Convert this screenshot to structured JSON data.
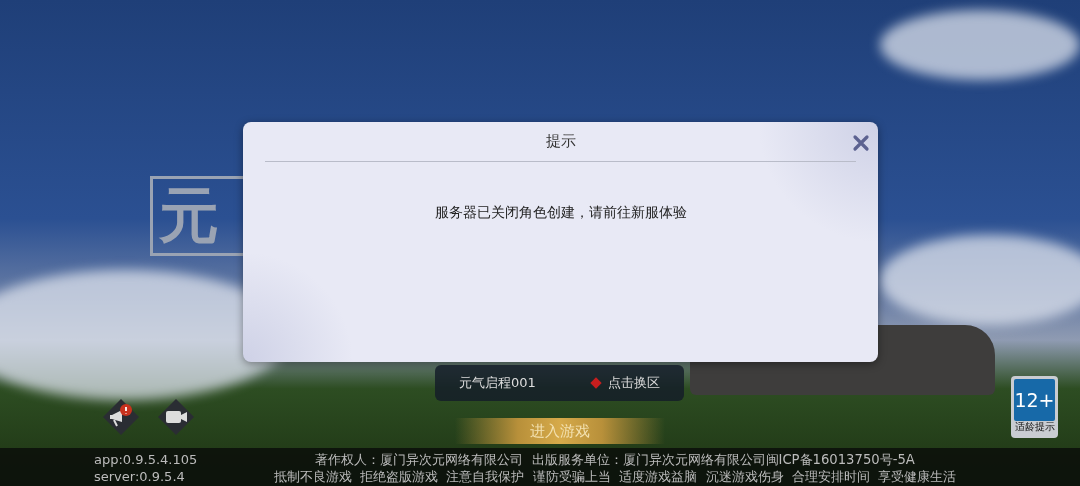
{
  "background_logo": {
    "text": "元"
  },
  "dialog": {
    "title": "提示",
    "message": "服务器已关闭角色创建，请前往新服体验"
  },
  "server_selector": {
    "server_name": "元气启程001",
    "switch_label": "点击换区"
  },
  "enter_button": {
    "label": "进入游戏"
  },
  "age_rating": {
    "rating": "12+",
    "label": "适龄提示"
  },
  "footer": {
    "version_lines": [
      "app:0.9.5.4.105",
      "server:0.9.5.4"
    ],
    "legal_lines": [
      "著作权人：厦门异次元网络有限公司  出版服务单位：厦门异次元网络有限公司闽ICP备16013750号-5A",
      "抵制不良游戏  拒绝盗版游戏  注意自我保护  谨防受骗上当  适度游戏益脑  沉迷游戏伤身  合理安排时间  享受健康生活"
    ]
  }
}
